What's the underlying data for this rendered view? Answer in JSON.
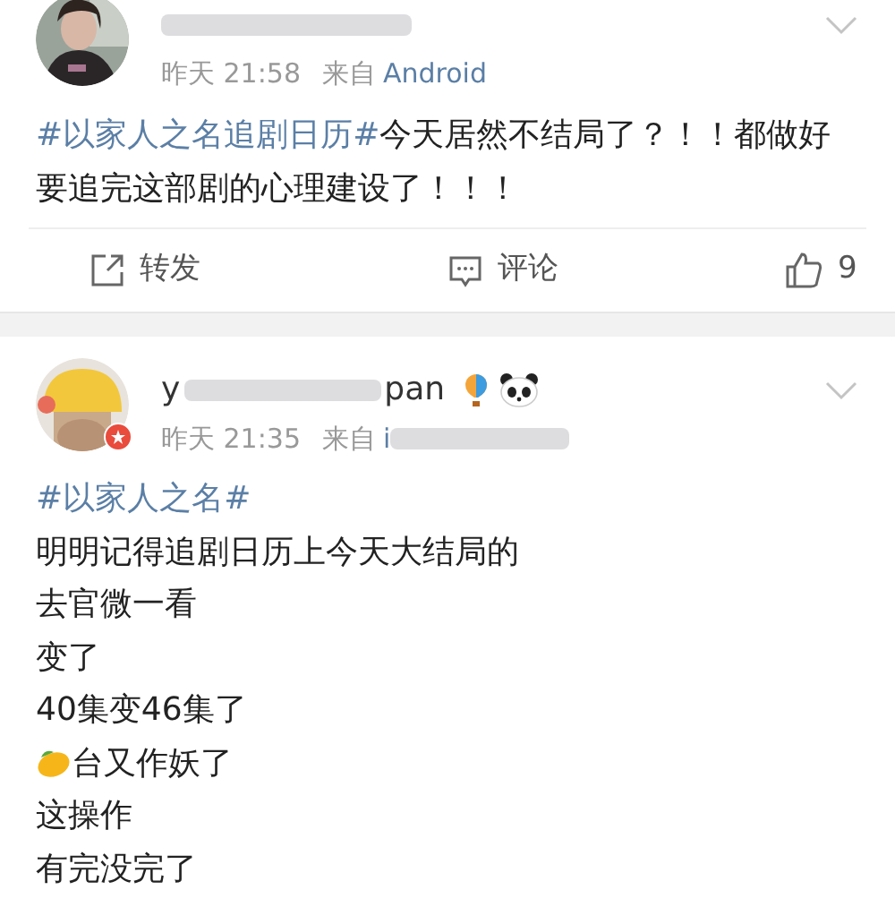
{
  "posts": [
    {
      "time": "昨天 21:58",
      "source_label": "来自",
      "source": "Android",
      "source_blurred": false,
      "hashtag": "#以家人之名追剧日历#",
      "body": "今天居然不结局了？！！都做好要追完这部剧的心理建设了！！！",
      "actions": {
        "repost": "转发",
        "comment": "评论",
        "like_count": "9"
      }
    },
    {
      "name_parts": [
        "y",
        "pan"
      ],
      "time": "昨天 21:35",
      "source_label": "来自",
      "source": "i",
      "source_blurred": true,
      "hashtag": "#以家人之名#",
      "lines": [
        {
          "kind": "text",
          "text": "明明记得追剧日历上今天大结局的"
        },
        {
          "kind": "text",
          "text": "去官微一看"
        },
        {
          "kind": "text",
          "text": "变了"
        },
        {
          "kind": "text",
          "text": "40集变46集了"
        },
        {
          "kind": "mango",
          "text": "台又作妖了"
        },
        {
          "kind": "text",
          "text": "这操作"
        },
        {
          "kind": "text",
          "text": "有完没完了"
        }
      ]
    }
  ]
}
